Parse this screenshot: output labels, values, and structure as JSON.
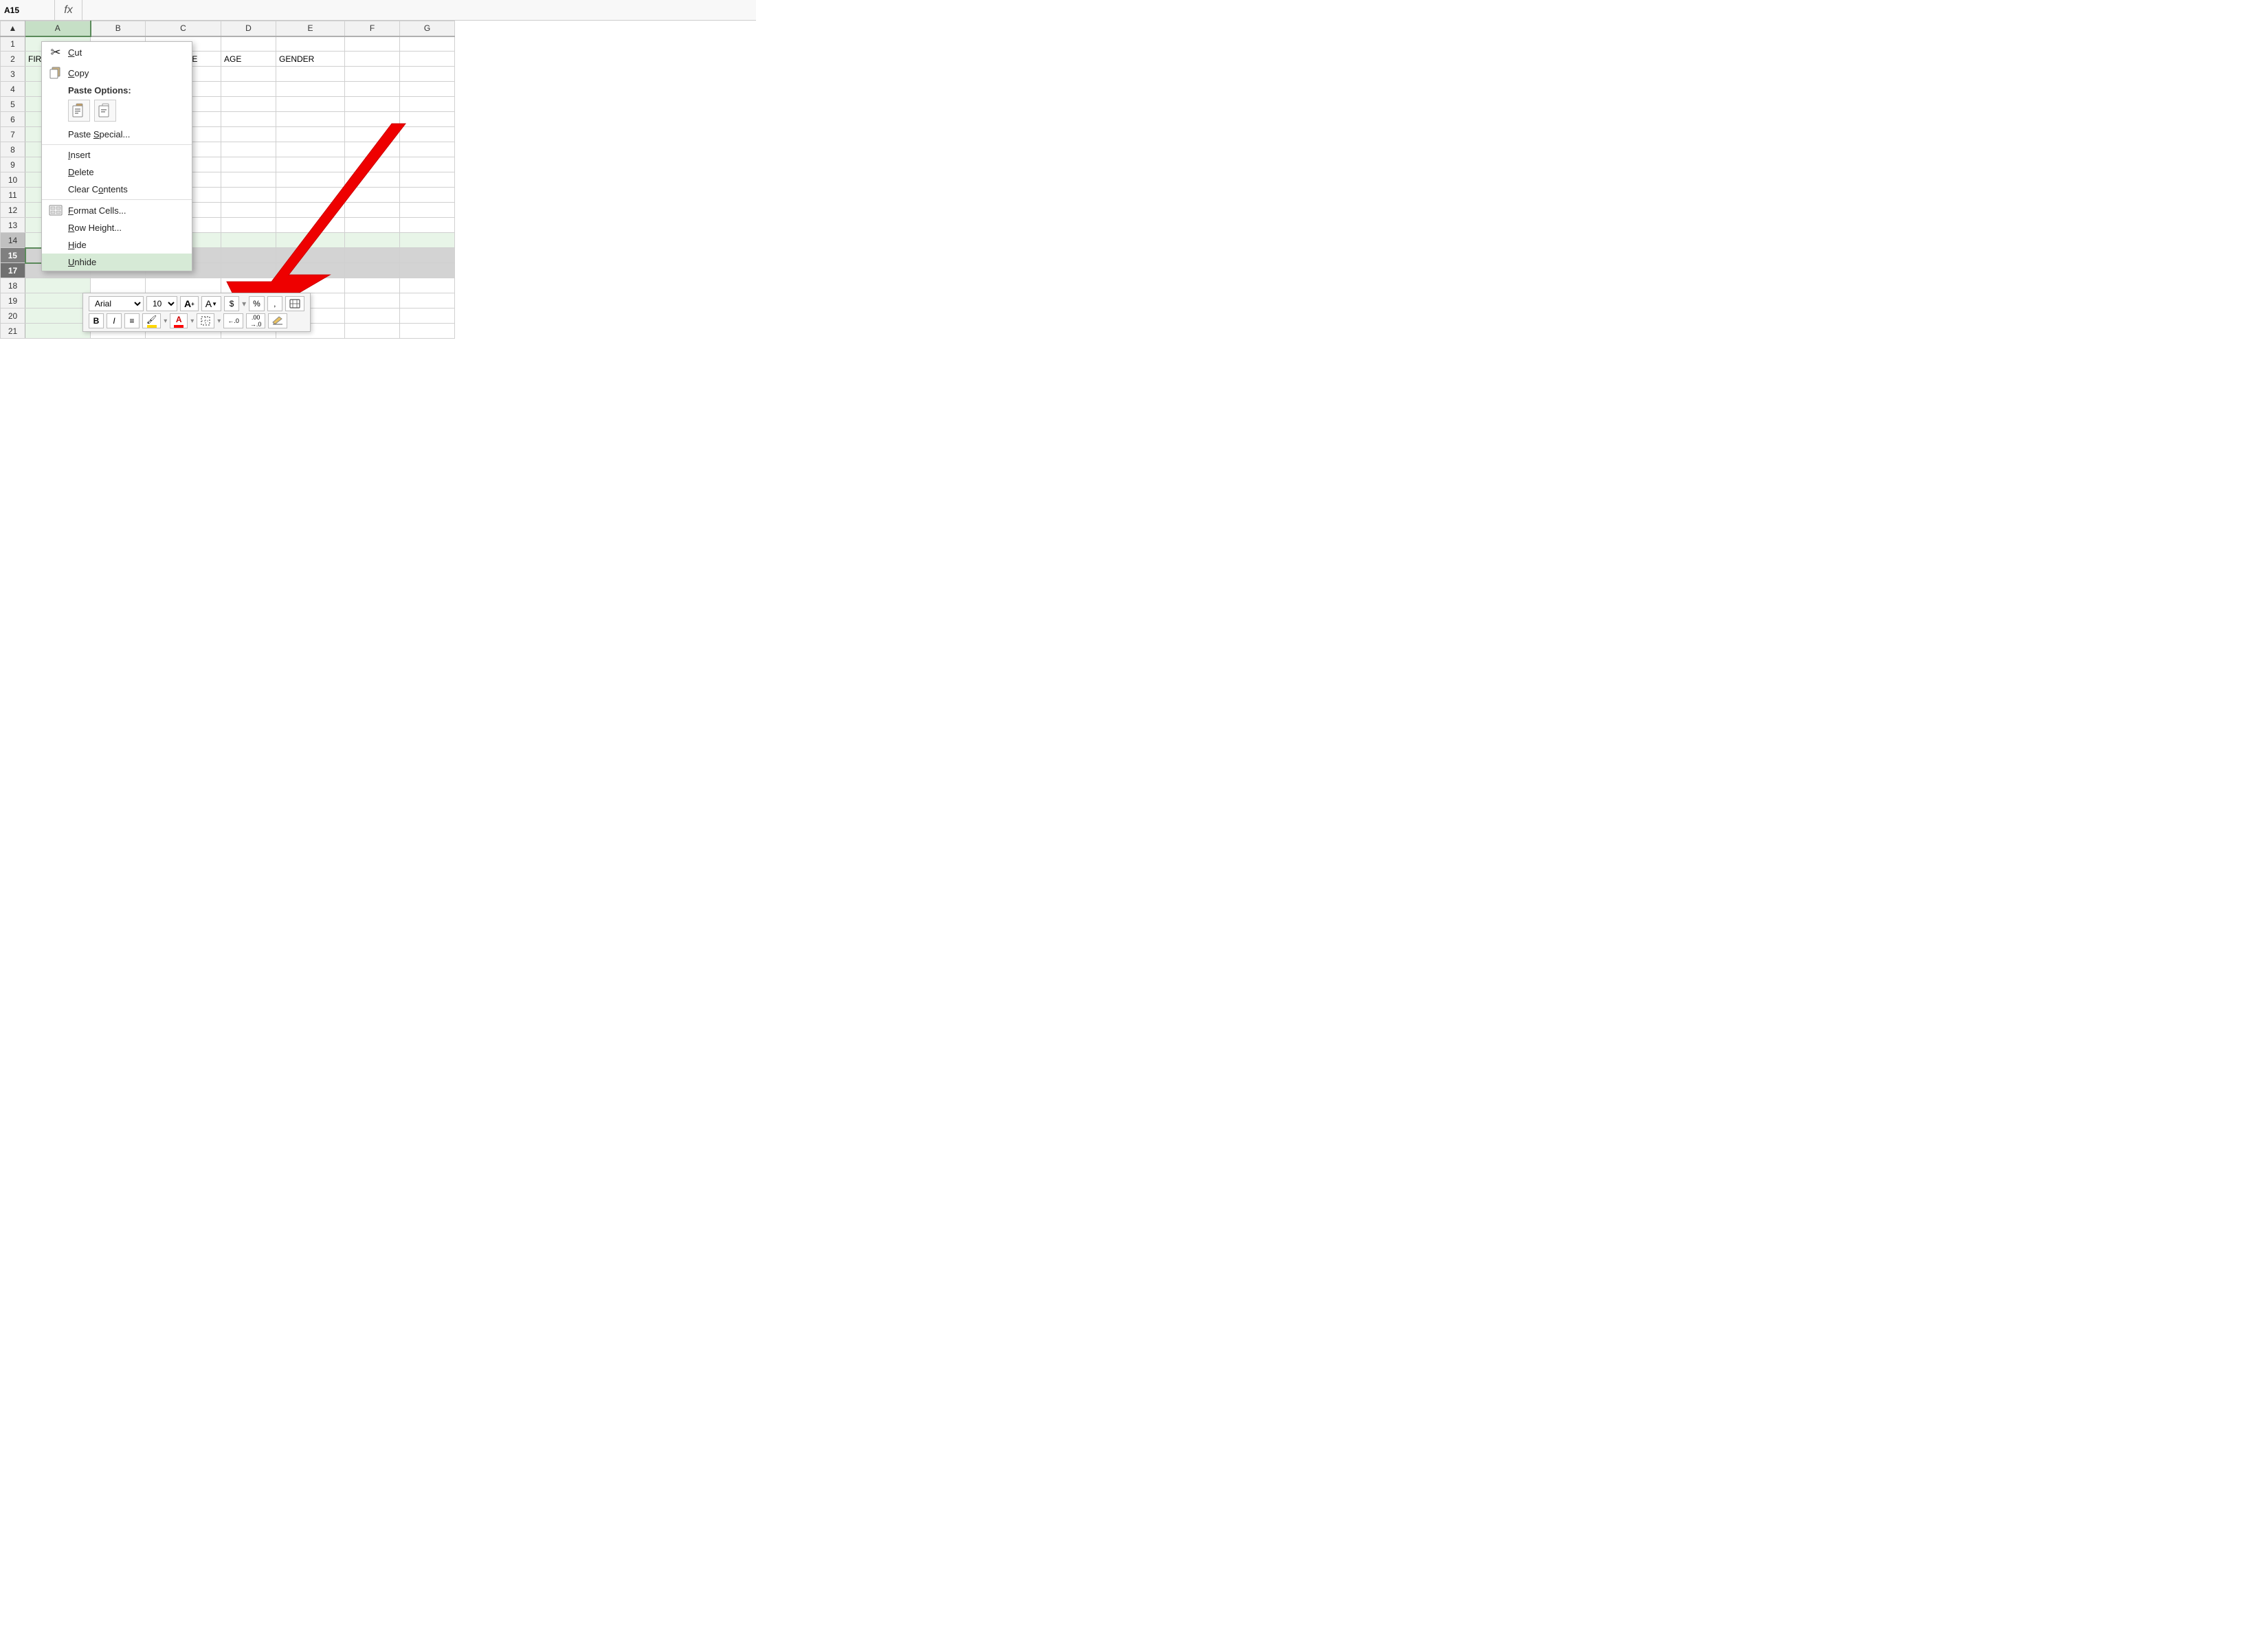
{
  "formula_bar": {
    "cell_ref": "A15",
    "fx_label": "fx",
    "formula_value": ""
  },
  "columns": [
    "A",
    "B",
    "C",
    "D",
    "E",
    "F",
    "G"
  ],
  "rows": [
    {
      "num": 1,
      "cells": [
        "",
        "",
        "",
        "",
        "",
        "",
        ""
      ]
    },
    {
      "num": 2,
      "cells": [
        "FIRST_N",
        "",
        "LAST_NAME",
        "AGE",
        "GENDER",
        "",
        ""
      ]
    },
    {
      "num": 3,
      "cells": [
        "",
        "",
        "",
        "",
        "",
        "",
        ""
      ]
    },
    {
      "num": 4,
      "cells": [
        "",
        "",
        "",
        "",
        "",
        "",
        ""
      ]
    },
    {
      "num": 5,
      "cells": [
        "",
        "",
        "",
        "",
        "",
        "",
        ""
      ]
    },
    {
      "num": 6,
      "cells": [
        "",
        "",
        "",
        "",
        "",
        "",
        ""
      ]
    },
    {
      "num": 7,
      "cells": [
        "",
        "",
        "",
        "",
        "",
        "",
        ""
      ]
    },
    {
      "num": 8,
      "cells": [
        "",
        "",
        "",
        "",
        "",
        "",
        ""
      ]
    },
    {
      "num": 9,
      "cells": [
        "",
        "",
        "",
        "",
        "",
        "",
        ""
      ]
    },
    {
      "num": 10,
      "cells": [
        "",
        "",
        "",
        "",
        "",
        "",
        ""
      ]
    },
    {
      "num": 11,
      "cells": [
        "",
        "",
        "",
        "",
        "",
        "",
        ""
      ]
    },
    {
      "num": 12,
      "cells": [
        "",
        "",
        "",
        "",
        "",
        "",
        ""
      ]
    },
    {
      "num": 13,
      "cells": [
        "",
        "",
        "",
        "",
        "",
        "",
        ""
      ]
    },
    {
      "num": 14,
      "cells": [
        "",
        "",
        "",
        "",
        "",
        "",
        ""
      ]
    },
    {
      "num": 15,
      "cells": [
        "",
        "",
        "",
        "",
        "",
        "",
        ""
      ]
    },
    {
      "num": 17,
      "cells": [
        "",
        "",
        "",
        "",
        "",
        "",
        ""
      ]
    },
    {
      "num": 18,
      "cells": [
        "",
        "",
        "",
        "",
        "",
        "",
        ""
      ]
    },
    {
      "num": 19,
      "cells": [
        "",
        "",
        "",
        "",
        "",
        "",
        ""
      ]
    },
    {
      "num": 20,
      "cells": [
        "",
        "",
        "",
        "",
        "",
        "",
        ""
      ]
    },
    {
      "num": 21,
      "cells": [
        "",
        "",
        "",
        "",
        "",
        "",
        ""
      ]
    }
  ],
  "context_menu": {
    "items": [
      {
        "id": "cut",
        "label": "Cut",
        "icon": "✂",
        "has_icon": true,
        "ul_char": "C",
        "ul_index": 0
      },
      {
        "id": "copy",
        "label": "Copy",
        "icon": "⧉",
        "has_icon": true,
        "ul_char": "C",
        "ul_index": 0
      },
      {
        "id": "paste_options_label",
        "label": "Paste Options:",
        "type": "paste_label"
      },
      {
        "id": "paste_icons",
        "type": "paste_icons"
      },
      {
        "id": "paste_special",
        "label": "Paste Special...",
        "has_icon": false,
        "ul_char": "S",
        "ul_index": 6
      },
      {
        "id": "sep1",
        "type": "separator"
      },
      {
        "id": "insert",
        "label": "Insert",
        "has_icon": false,
        "ul_char": "I",
        "ul_index": 0
      },
      {
        "id": "delete",
        "label": "Delete",
        "has_icon": false,
        "ul_char": "D",
        "ul_index": 0
      },
      {
        "id": "clear_contents",
        "label": "Clear Contents",
        "has_icon": false,
        "ul_char": "o",
        "ul_index": 6
      },
      {
        "id": "sep2",
        "type": "separator"
      },
      {
        "id": "format_cells",
        "label": "Format Cells...",
        "icon": "⊞",
        "has_icon": true,
        "ul_char": "F",
        "ul_index": 0
      },
      {
        "id": "row_height",
        "label": "Row Height...",
        "has_icon": false,
        "ul_char": "R",
        "ul_index": 0
      },
      {
        "id": "hide",
        "label": "Hide",
        "has_icon": false,
        "ul_char": "H",
        "ul_index": 0
      },
      {
        "id": "unhide",
        "label": "Unhide",
        "has_icon": false,
        "ul_char": "U",
        "ul_index": 0,
        "highlighted": true
      }
    ]
  },
  "mini_toolbar": {
    "font_name": "Arial",
    "font_size": "10",
    "buttons_row1": [
      "A↑",
      "A↓",
      "$",
      "%",
      ",",
      "⊟"
    ],
    "buttons_row2": [
      "B",
      "I",
      "≡",
      "highlight",
      "A",
      "borders",
      "←.0",
      ".00→.0",
      "eraser"
    ]
  },
  "colors": {
    "header_bg": "#f2f2f2",
    "selected_col_header": "#c6dfc6",
    "selected_col_border": "#5a8a5a",
    "selected_row_bg": "#d3d3d3",
    "row14_bg": "#e8f5e8",
    "context_menu_bg": "#ffffff",
    "context_menu_border": "#bbbbbb",
    "unhide_highlight": "#d6ead6",
    "red_arrow": "#ee0000"
  }
}
